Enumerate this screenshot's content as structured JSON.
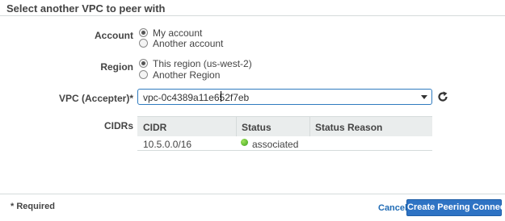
{
  "section": {
    "title": "Select another VPC to peer with"
  },
  "account": {
    "label": "Account",
    "options": [
      {
        "label": "My account",
        "checked": true
      },
      {
        "label": "Another account",
        "checked": false
      }
    ]
  },
  "region": {
    "label": "Region",
    "options": [
      {
        "label": "This region (us-west-2)",
        "checked": true
      },
      {
        "label": "Another Region",
        "checked": false
      }
    ]
  },
  "vpc": {
    "label": "VPC (Accepter)*",
    "value": "vpc-0c4389a11e652f7eb",
    "refresh_icon": "refresh-icon"
  },
  "cidrs": {
    "label": "CIDRs",
    "columns": [
      "CIDR",
      "Status",
      "Status Reason"
    ],
    "rows": [
      {
        "cidr": "10.5.0.0/16",
        "status": "associated",
        "status_reason": "",
        "status_color": "#3ea21d"
      }
    ]
  },
  "footer": {
    "required_note": "* Required",
    "cancel_label": "Cancel",
    "submit_label": "Create Peering Connection"
  },
  "colors": {
    "primary": "#2e73c4",
    "link": "#1f6bb5",
    "focus": "#2f7bbf"
  }
}
